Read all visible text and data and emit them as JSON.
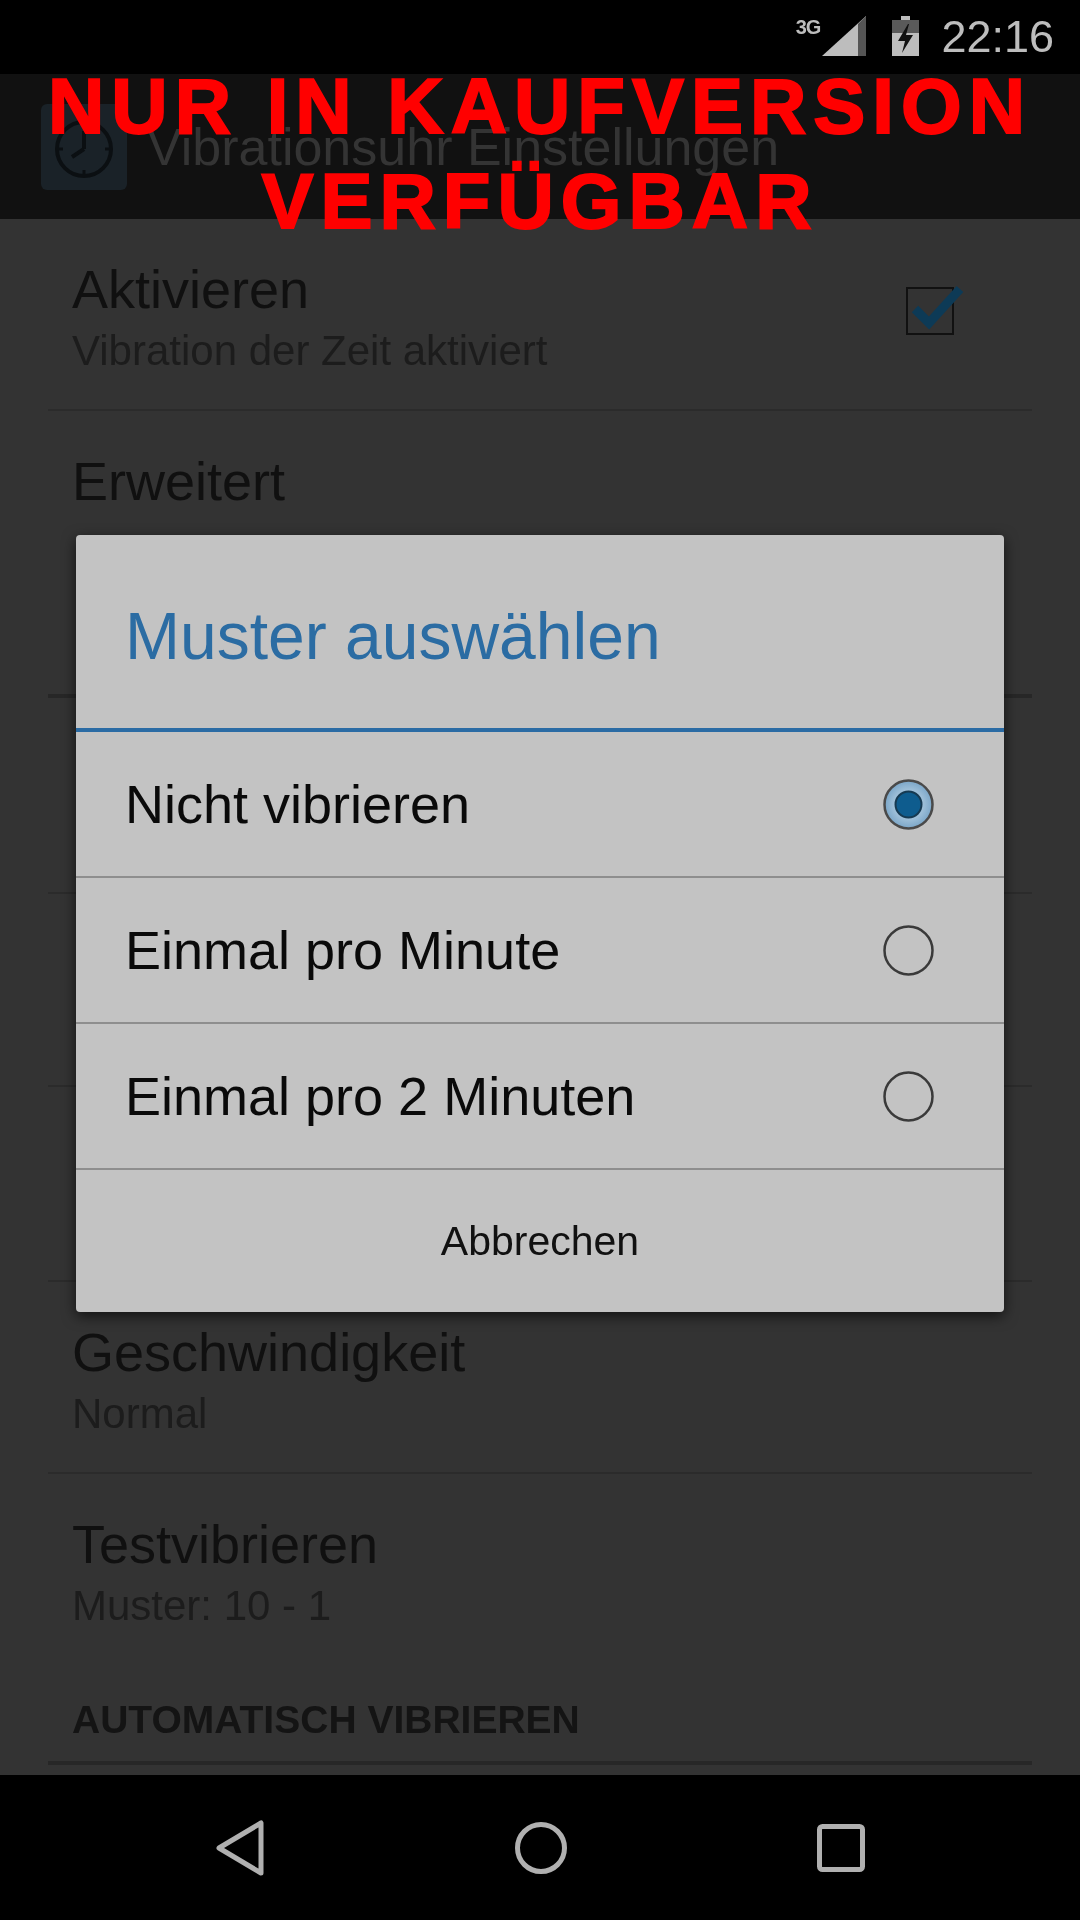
{
  "status_bar": {
    "network": "3G",
    "time": "22:16"
  },
  "action_bar": {
    "title": "Vibrationsuhr Einstellungen"
  },
  "promo_overlay": {
    "lines": [
      "NUR IN KAUFVERSION",
      "VERFÜGBAR"
    ]
  },
  "preferences": [
    {
      "kind": "checkbox",
      "title": "Aktivieren",
      "summary": "Vibration der Zeit aktiviert",
      "checked": true
    },
    {
      "kind": "plain",
      "title": "Erweitert"
    },
    {
      "kind": "plain",
      "title": "Geschwindigkeit",
      "summary": "Normal"
    },
    {
      "kind": "plain",
      "title": "Testvibrieren",
      "summary": "Muster: 10 - 1"
    },
    {
      "kind": "category",
      "title": "AUTOMATISCH VIBRIEREN"
    }
  ],
  "dialog": {
    "title": "Muster auswählen",
    "options": [
      {
        "label": "Nicht vibrieren",
        "selected": true
      },
      {
        "label": "Einmal pro Minute",
        "selected": false
      },
      {
        "label": "Einmal pro 2 Minuten",
        "selected": false
      }
    ],
    "cancel_button": "Abbrechen"
  }
}
